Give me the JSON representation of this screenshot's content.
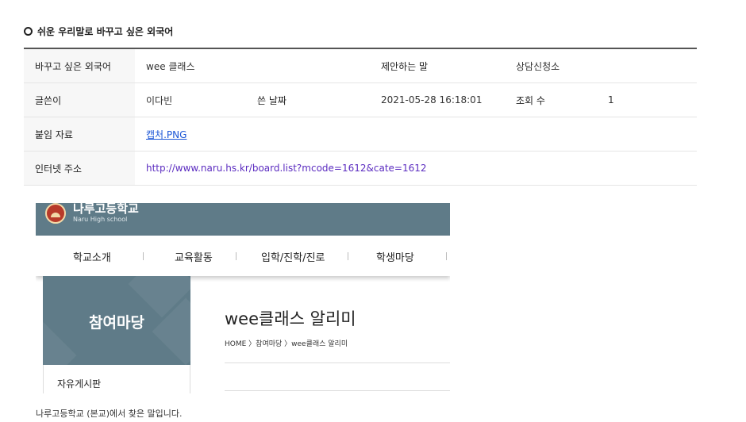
{
  "section_title": "쉬운 우리말로 바꾸고 싶은 외국어",
  "table": {
    "row1": {
      "label": "바꾸고 싶은 외국어",
      "value": "wee 클래스",
      "label2": "제안하는 말",
      "value2": "상담신청소"
    },
    "row2": {
      "label": "글쓴이",
      "value": "이다빈",
      "label2": "쓴 날짜",
      "value2": "2021-05-28 16:18:01",
      "label3": "조회 수",
      "value3": "1"
    },
    "row3": {
      "label": "붙임 자료",
      "value": "캡처.PNG"
    },
    "row4": {
      "label": "인터넷 주소",
      "value": "http://www.naru.hs.kr/board.list?mcode=1612&cate=1612"
    }
  },
  "screenshot": {
    "school_name": "나루고등학교",
    "school_name_en": "Naru High school",
    "nav": [
      "학교소개",
      "교육활동",
      "입학/진학/진로",
      "학생마당"
    ],
    "side_title": "참여마당",
    "side_menu_item": "자유게시판",
    "page_title": "wee클래스 알리미",
    "breadcrumb": "HOME 〉참여마당 〉wee클래스 알리미"
  },
  "caption": "나루고등학교 (본교)에서 찾은 말입니다."
}
